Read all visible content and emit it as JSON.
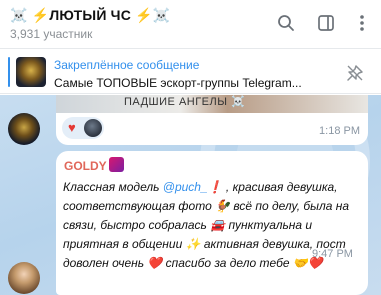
{
  "header": {
    "title": "☠️ ⚡ЛЮТЫЙ ЧС ⚡☠️",
    "subtitle": "3,931 участник",
    "icons": [
      "search-icon",
      "sidebar-toggle-icon",
      "more-vertical-icon"
    ]
  },
  "pinned": {
    "title": "Закреплённое сообщение",
    "text": "Самые ТОПОВЫЕ эскорт-группы Telegram...",
    "icon": "unpin-icon"
  },
  "messages": [
    {
      "caption": "ПАДШИЕ АНГЕЛЫ ☠️",
      "reaction": "♥",
      "time": "1:18 PM"
    },
    {
      "sender": "GOLDY",
      "text_before": "Классная модель ",
      "mention": "@puch_",
      "text_after": "❗ , красивая девушка, соответствующая фото 🐓 всё по делу, была на связи, быстро собралась 🚘 пунктуальна и приятная в общении ✨ активная девушка, пост доволен очень ❤️ спасибо за дело тебе 🤝❤️",
      "time": "9:47 PM"
    }
  ],
  "colors": {
    "accent": "#3390ec",
    "sender": "#e0675a",
    "chat_bg": "#b6d3ec"
  }
}
